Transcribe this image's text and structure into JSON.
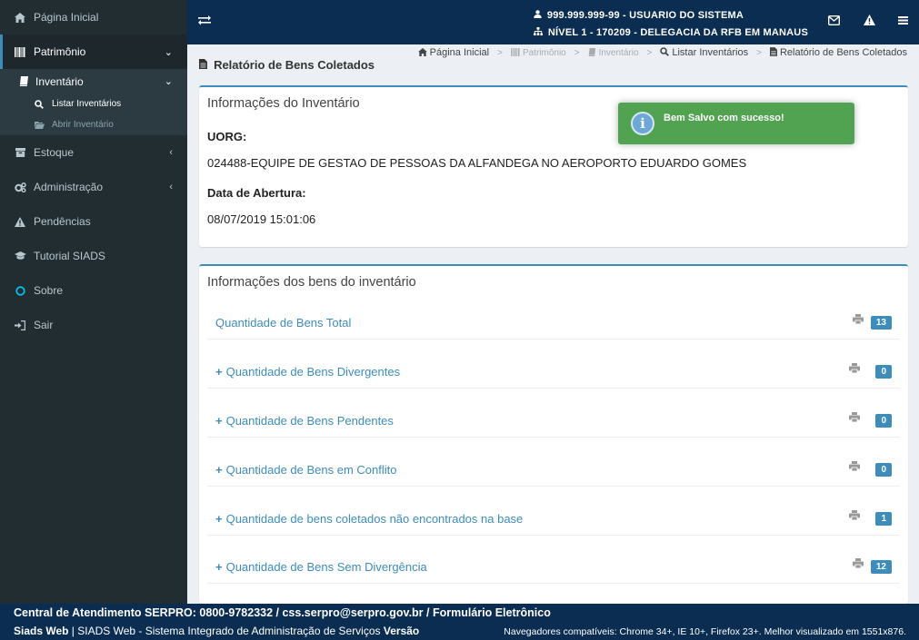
{
  "sidebar": {
    "home": "Página Inicial",
    "patrimonio": "Patrimônio",
    "inventario": "Inventário",
    "listar": "Listar Inventários",
    "abrir": "Abrir Inventário",
    "estoque": "Estoque",
    "administracao": "Administração",
    "pendencias": "Pendências",
    "tutorial": "Tutorial SIADS",
    "sobre": "Sobre",
    "sair": "Sair"
  },
  "header": {
    "user_line": "999.999.999-99 - USUARIO DO SISTEMA",
    "level_line": "NÍVEL 1 - 170209 - DELEGACIA DA RFB EM MANAUS"
  },
  "breadcrumb": {
    "home": "Página Inicial",
    "patrimonio": "Patrimônio",
    "inventario": "Inventário",
    "listar": "Listar Inventários",
    "current": "Relatório de Bens Coletados"
  },
  "page": {
    "title": "Relatório de Bens Coletados"
  },
  "inventory_info": {
    "title": "Informações do Inventário",
    "uorg_label": "UORG:",
    "uorg_value": "024488-EQUIPE DE GESTAO DE PESSOAS DA ALFANDEGA NO AEROPORTO EDUARDO GOMES",
    "date_label": "Data de Abertura:",
    "date_value": "08/07/2019 15:01:06"
  },
  "goods_info": {
    "title": "Informações dos bens do inventário",
    "items": [
      {
        "label": "Quantidade de Bens Total",
        "count": "13",
        "expandable": false
      },
      {
        "label": "Quantidade de Bens Divergentes",
        "count": "0",
        "expandable": true
      },
      {
        "label": "Quantidade de Bens Pendentes",
        "count": "0",
        "expandable": true
      },
      {
        "label": "Quantidade de Bens em Conflito",
        "count": "0",
        "expandable": true
      },
      {
        "label": "Quantidade de bens coletados não encontrados na base",
        "count": "1",
        "expandable": true
      },
      {
        "label": "Quantidade de Bens Sem Divergência",
        "count": "12",
        "expandable": true
      }
    ]
  },
  "toast": {
    "message": "Bem Salvo com sucesso!"
  },
  "footer": {
    "line1": "Central de Atendimento SERPRO: 0800-9782332 / css.serpro@serpro.gov.br / Formulário Eletrônico",
    "app_name": "Siads Web",
    "app_desc": " | SIADS Web - Sistema Integrado de Administração de Serviços ",
    "version_label": "Versão",
    "browsers": "Navegadores compatíveis: Chrome 34+, IE 10+, Firefox 23+. Melhor visualizado em 1551x876."
  },
  "icons": {
    "home": "home-icon",
    "patrimonio": "barcode-icon",
    "inventario": "book-icon",
    "listar": "search-icon",
    "abrir": "folder-open-icon",
    "estoque": "archive-icon",
    "administracao": "cogs-icon",
    "pendencias": "warning-icon",
    "tutorial": "graduation-cap-icon",
    "sobre": "circle-icon",
    "sair": "sign-in-icon"
  },
  "colors": {
    "sidebar_bg": "#222d32",
    "header_bg": "#0b2d52",
    "accent": "#3c8dbc",
    "toast_green": "#51a351"
  }
}
